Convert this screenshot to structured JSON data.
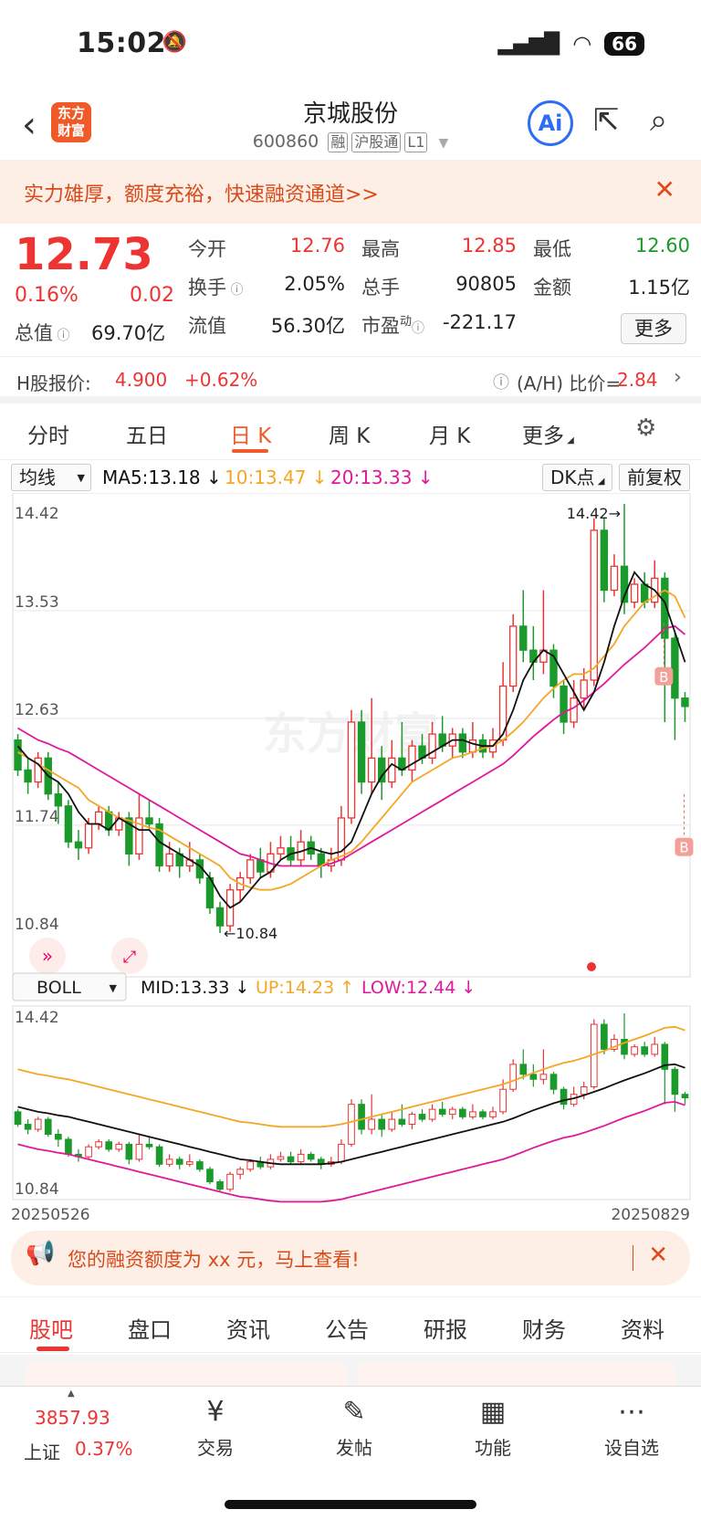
{
  "status": {
    "time": "15:02",
    "battery": "66"
  },
  "nav": {
    "title": "京城股份",
    "code": "600860",
    "tags": [
      "融",
      "沪股通",
      "L1"
    ],
    "logo_line1": "东方",
    "logo_line2": "财富",
    "ai_label": "Ai"
  },
  "banner": {
    "text": "实力雄厚，额度充裕，快速融资通道>>"
  },
  "quote": {
    "price": "12.73",
    "pct": "0.16%",
    "change": "0.02",
    "zongzhi_label": "总值",
    "zongzhi": "69.70亿",
    "fields": [
      {
        "label": "今开",
        "value": "12.76"
      },
      {
        "label": "最高",
        "value": "12.85"
      },
      {
        "label": "最低",
        "value": "12.60"
      },
      {
        "label": "换手",
        "value": "2.05%"
      },
      {
        "label": "总手",
        "value": "90805"
      },
      {
        "label": "金额",
        "value": "1.15亿"
      },
      {
        "label": "流值",
        "value": "56.30亿"
      },
      {
        "label": "市盈",
        "value": "-221.17"
      }
    ],
    "more": "更多"
  },
  "hshare": {
    "label": "H股报价:",
    "price": "4.900",
    "pct": "+0.62%",
    "ratio_label": "(A/H) 比价=",
    "ratio": "2.84"
  },
  "tabs": [
    "分时",
    "五日",
    "日 K",
    "周 K",
    "月 K",
    "更多"
  ],
  "ma": {
    "selector": "均线",
    "ma5": "MA5:13.18",
    "ma10": "10:13.47",
    "ma20": "20:13.33",
    "dk": "DK点",
    "fq": "前复权"
  },
  "boll": {
    "selector": "BOLL",
    "mid": "MID:13.33",
    "up": "UP:14.23",
    "low": "LOW:12.44"
  },
  "chart_data": {
    "type": "candlestick",
    "watermark": "东方财富",
    "main": {
      "yticks": [
        "14.42",
        "13.53",
        "12.63",
        "11.74",
        "10.84"
      ],
      "high_label": "14.42",
      "low_label": "10.84",
      "signal": "B"
    },
    "sub": {
      "yticks": [
        "14.42",
        "10.84"
      ]
    },
    "x_start": "20250526",
    "x_end": "20250829",
    "ylim": [
      10.84,
      14.42
    ],
    "series": [
      {
        "name": "MA5",
        "color": "#111111"
      },
      {
        "name": "MA10",
        "color": "#f5a623"
      },
      {
        "name": "MA20",
        "color": "#e0189a"
      }
    ],
    "candles": [
      [
        12.45,
        12.2,
        12.5,
        12.15
      ],
      [
        12.2,
        12.1,
        12.3,
        12.0
      ],
      [
        12.1,
        12.3,
        12.35,
        12.05
      ],
      [
        12.3,
        12.0,
        12.35,
        11.95
      ],
      [
        12.0,
        11.9,
        12.1,
        11.75
      ],
      [
        11.9,
        11.6,
        11.95,
        11.55
      ],
      [
        11.6,
        11.55,
        11.7,
        11.45
      ],
      [
        11.55,
        11.75,
        11.8,
        11.5
      ],
      [
        11.75,
        11.85,
        11.9,
        11.7
      ],
      [
        11.85,
        11.7,
        11.9,
        11.65
      ],
      [
        11.7,
        11.8,
        11.85,
        11.65
      ],
      [
        11.8,
        11.5,
        11.85,
        11.4
      ],
      [
        11.5,
        11.8,
        12.0,
        11.45
      ],
      [
        11.8,
        11.75,
        11.95,
        11.7
      ],
      [
        11.75,
        11.4,
        11.8,
        11.35
      ],
      [
        11.4,
        11.5,
        11.6,
        11.35
      ],
      [
        11.5,
        11.4,
        11.55,
        11.3
      ],
      [
        11.4,
        11.45,
        11.6,
        11.35
      ],
      [
        11.45,
        11.3,
        11.5,
        11.25
      ],
      [
        11.3,
        11.05,
        11.35,
        11.0
      ],
      [
        11.05,
        10.9,
        11.1,
        10.84
      ],
      [
        10.9,
        11.2,
        11.25,
        10.85
      ],
      [
        11.2,
        11.3,
        11.35,
        11.1
      ],
      [
        11.3,
        11.45,
        11.5,
        11.25
      ],
      [
        11.45,
        11.35,
        11.55,
        11.3
      ],
      [
        11.35,
        11.5,
        11.6,
        11.3
      ],
      [
        11.5,
        11.55,
        11.65,
        11.45
      ],
      [
        11.55,
        11.45,
        11.65,
        11.4
      ],
      [
        11.45,
        11.6,
        11.7,
        11.4
      ],
      [
        11.6,
        11.5,
        11.65,
        11.45
      ],
      [
        11.5,
        11.4,
        11.55,
        11.3
      ],
      [
        11.4,
        11.45,
        11.55,
        11.35
      ],
      [
        11.45,
        11.8,
        11.9,
        11.4
      ],
      [
        11.8,
        12.6,
        12.7,
        11.75
      ],
      [
        12.6,
        12.1,
        12.7,
        12.0
      ],
      [
        12.1,
        12.3,
        12.8,
        12.0
      ],
      [
        12.3,
        12.1,
        12.4,
        11.95
      ],
      [
        12.1,
        12.3,
        12.45,
        12.05
      ],
      [
        12.3,
        12.2,
        12.6,
        12.15
      ],
      [
        12.2,
        12.4,
        12.45,
        12.1
      ],
      [
        12.4,
        12.3,
        12.5,
        12.25
      ],
      [
        12.3,
        12.5,
        12.6,
        12.25
      ],
      [
        12.5,
        12.4,
        12.65,
        12.35
      ],
      [
        12.4,
        12.5,
        12.55,
        12.3
      ],
      [
        12.5,
        12.35,
        12.55,
        12.3
      ],
      [
        12.35,
        12.45,
        12.6,
        12.3
      ],
      [
        12.45,
        12.35,
        12.5,
        12.3
      ],
      [
        12.35,
        12.45,
        12.55,
        12.3
      ],
      [
        12.45,
        12.9,
        13.1,
        12.4
      ],
      [
        12.9,
        13.4,
        13.5,
        12.85
      ],
      [
        13.4,
        13.2,
        13.7,
        13.1
      ],
      [
        13.2,
        13.1,
        13.4,
        12.95
      ],
      [
        13.1,
        13.2,
        13.7,
        13.0
      ],
      [
        13.2,
        12.9,
        13.25,
        12.8
      ],
      [
        12.9,
        12.6,
        12.95,
        12.5
      ],
      [
        12.6,
        12.8,
        12.95,
        12.55
      ],
      [
        12.8,
        12.95,
        13.05,
        12.7
      ],
      [
        12.95,
        14.2,
        14.3,
        12.9
      ],
      [
        14.2,
        13.7,
        14.3,
        13.6
      ],
      [
        13.7,
        13.9,
        14.0,
        13.65
      ],
      [
        13.9,
        13.6,
        14.42,
        13.5
      ],
      [
        13.6,
        13.75,
        13.8,
        13.55
      ],
      [
        13.75,
        13.6,
        13.85,
        13.55
      ],
      [
        13.6,
        13.8,
        13.95,
        13.55
      ],
      [
        13.8,
        13.3,
        13.85,
        12.6
      ],
      [
        13.3,
        12.8,
        13.35,
        12.45
      ],
      [
        12.8,
        12.73,
        12.85,
        12.6
      ]
    ],
    "ma5": [
      12.4,
      12.3,
      12.25,
      12.15,
      12.1,
      12.0,
      11.85,
      11.75,
      11.75,
      11.7,
      11.8,
      11.75,
      11.7,
      11.7,
      11.6,
      11.55,
      11.5,
      11.45,
      11.4,
      11.3,
      11.15,
      11.05,
      11.1,
      11.2,
      11.3,
      11.35,
      11.45,
      11.5,
      11.52,
      11.55,
      11.52,
      11.5,
      11.52,
      11.6,
      11.8,
      12.0,
      12.15,
      12.25,
      12.2,
      12.25,
      12.3,
      12.35,
      12.4,
      12.45,
      12.45,
      12.42,
      12.4,
      12.4,
      12.5,
      12.7,
      12.95,
      13.1,
      13.2,
      13.15,
      13.0,
      12.85,
      12.7,
      12.85,
      13.1,
      13.4,
      13.65,
      13.85,
      13.75,
      13.7,
      13.6,
      13.35,
      13.1
    ],
    "ma10": [
      12.35,
      12.3,
      12.25,
      12.2,
      12.15,
      12.1,
      12.05,
      11.95,
      11.9,
      11.85,
      11.8,
      11.78,
      11.75,
      11.72,
      11.7,
      11.65,
      11.6,
      11.55,
      11.5,
      11.45,
      11.4,
      11.3,
      11.25,
      11.22,
      11.2,
      11.2,
      11.22,
      11.25,
      11.3,
      11.35,
      11.4,
      11.45,
      11.48,
      11.52,
      11.6,
      11.7,
      11.8,
      11.9,
      12.0,
      12.1,
      12.15,
      12.2,
      12.25,
      12.3,
      12.32,
      12.35,
      12.38,
      12.4,
      12.45,
      12.52,
      12.6,
      12.7,
      12.8,
      12.88,
      12.95,
      13.0,
      13.0,
      13.05,
      13.15,
      13.25,
      13.4,
      13.5,
      13.6,
      13.65,
      13.7,
      13.65,
      13.47
    ],
    "ma20": [
      12.55,
      12.5,
      12.45,
      12.42,
      12.38,
      12.35,
      12.3,
      12.25,
      12.2,
      12.15,
      12.1,
      12.05,
      12.0,
      11.95,
      11.9,
      11.85,
      11.8,
      11.75,
      11.7,
      11.65,
      11.6,
      11.55,
      11.5,
      11.48,
      11.45,
      11.42,
      11.4,
      11.4,
      11.4,
      11.4,
      11.4,
      11.42,
      11.45,
      11.5,
      11.55,
      11.6,
      11.65,
      11.7,
      11.75,
      11.8,
      11.85,
      11.9,
      11.95,
      12.0,
      12.05,
      12.1,
      12.15,
      12.2,
      12.25,
      12.32,
      12.4,
      12.48,
      12.55,
      12.62,
      12.68,
      12.72,
      12.78,
      12.85,
      12.92,
      13.0,
      13.08,
      13.15,
      13.22,
      13.3,
      13.38,
      13.4,
      13.33
    ]
  },
  "ad": {
    "text": "您的融资额度为 xx 元，马上查看!"
  },
  "content_tabs": [
    "股吧",
    "盘口",
    "资讯",
    "公告",
    "研报",
    "财务",
    "资料"
  ],
  "bottom": {
    "index_value": "3857.93",
    "index_name": "上证",
    "index_pct": "0.37%",
    "items": [
      "交易",
      "发帖",
      "功能",
      "设自选"
    ]
  }
}
